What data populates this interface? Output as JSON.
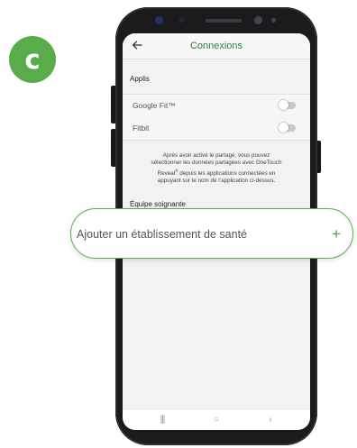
{
  "step_badge": "c",
  "header": {
    "title": "Connexions"
  },
  "apps_section": {
    "title": "Applis",
    "items": [
      {
        "label": "Google Fit™",
        "enabled": false
      },
      {
        "label": "Fitbit",
        "enabled": false
      }
    ],
    "help_lines": [
      "Après avoir activé le partage, vous pouvez",
      "sélectionner les données partagées avec OneTouch",
      "Reveal",
      "®",
      " depuis les applications connectées en",
      "appuyant sur le nom de l’application ci-dessus."
    ]
  },
  "care_team": {
    "title": "Équipe soignante",
    "add_label": "Ajouter un établissement de santé",
    "add_symbol": "+"
  },
  "nav_bar": {
    "recents": "|||",
    "home": "○",
    "back": "‹"
  },
  "colors": {
    "accent_green": "#5aac4a",
    "title_green": "#2f7d3a",
    "phone_body": "#1b1b1d"
  }
}
